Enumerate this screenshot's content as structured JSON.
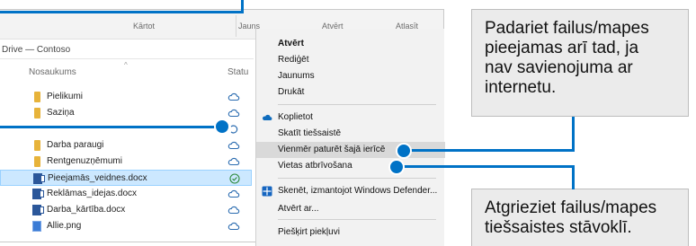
{
  "ribbon": {
    "sort": "Kārtot",
    "new": "Jauns",
    "open": "Atvērt",
    "select": "Atlasīt"
  },
  "address": "Drive — Contoso",
  "columns": {
    "name": "Nosaukums",
    "status": "Statu"
  },
  "files": [
    {
      "name": "Pielikumi",
      "type": "folder",
      "status": "cloud"
    },
    {
      "name": "Saziņa",
      "type": "folder",
      "status": "cloud"
    },
    {
      "name": "",
      "type": "none",
      "status": "syncing"
    },
    {
      "name": "Darba paraugi",
      "type": "folder",
      "status": "cloud"
    },
    {
      "name": "Rentgenuzņēmumi",
      "type": "folder",
      "status": "cloud"
    },
    {
      "name": "Pieejamās_veidnes.docx",
      "type": "word",
      "status": "available"
    },
    {
      "name": "Reklāmas_idejas.docx",
      "type": "word",
      "status": "cloud"
    },
    {
      "name": "Darba_kārtība.docx",
      "type": "word",
      "status": "cloud"
    },
    {
      "name": "Allie.png",
      "type": "image",
      "status": "cloud"
    }
  ],
  "context_menu": {
    "open": "Atvērt",
    "edit": "Rediģēt",
    "new": "Jaunums",
    "print": "Drukāt",
    "share": "Koplietot",
    "view_online": "Skatīt tiešsaistē",
    "keep_on_device": "Vienmēr paturēt šajā ierīcē",
    "free_space": "Vietas atbrīvošana",
    "scan": "Skenēt, izmantojot Windows Defender...",
    "open_with": "Atvērt ar...",
    "give_access": "Piešķirt piekļuvi"
  },
  "callouts": {
    "keep_lines": [
      "Padariet failus/mapes",
      "pieejamas arī tad, ja",
      "nav savienojuma ar",
      "internetu."
    ],
    "free_lines": [
      "Atgrieziet failus/mapes",
      "tiešsaistes stāvoklī."
    ]
  },
  "colors": {
    "accent": "#0072c6",
    "selected": "#cce8ff",
    "menu_bg": "#f2f2f2",
    "callout_bg": "#ebebeb"
  }
}
